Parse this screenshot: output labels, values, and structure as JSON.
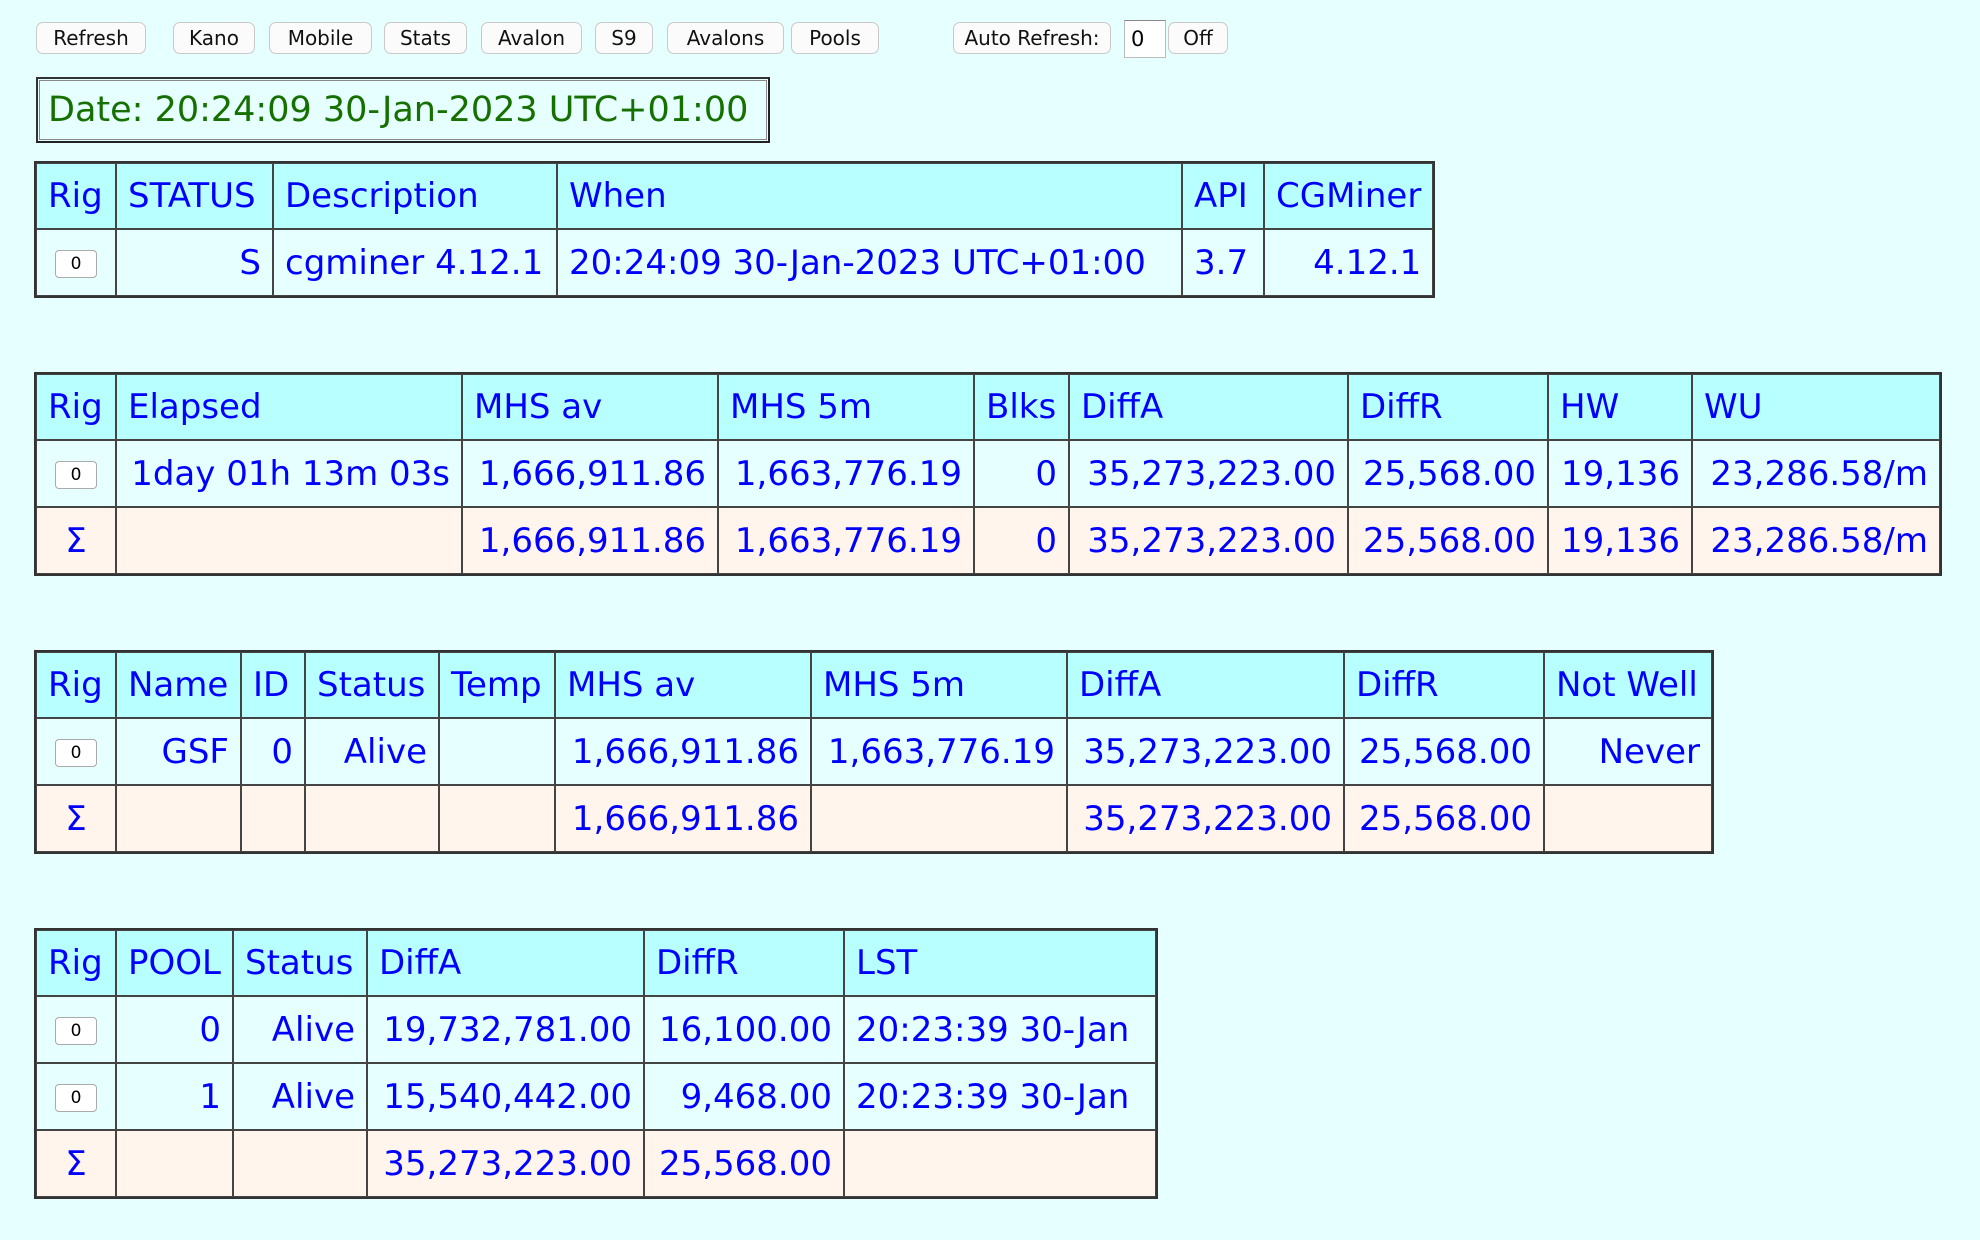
{
  "toolbar": {
    "buttons": [
      "Refresh",
      "Kano",
      "Mobile",
      "Stats",
      "Avalon",
      "S9",
      "Avalons",
      "Pools"
    ],
    "auto_refresh_label": "Auto Refresh:",
    "auto_refresh_value": "0",
    "off_label": "Off"
  },
  "date": "Date: 20:24:09 30-Jan-2023 UTC+01:00",
  "summary": {
    "headers": [
      "Rig",
      "STATUS",
      "Description",
      "When",
      "API",
      "CGMiner"
    ],
    "row": {
      "rig": "0",
      "status": "S",
      "description": "cgminer 4.12.1",
      "when": "20:24:09 30-Jan-2023 UTC+01:00",
      "api": "3.7",
      "cgminer": "4.12.1"
    }
  },
  "devs": {
    "headers": [
      "Rig",
      "Elapsed",
      "MHS av",
      "MHS 5m",
      "Blks",
      "DiffA",
      "DiffR",
      "HW",
      "WU"
    ],
    "row": {
      "rig": "0",
      "elapsed": "1day 01h 13m 03s",
      "mhs_av": "1,666,911.86",
      "mhs_5m": "1,663,776.19",
      "blks": "0",
      "diffa": "35,273,223.00",
      "diffr": "25,568.00",
      "hw": "19,136",
      "wu": "23,286.58/m"
    },
    "total": {
      "rig": "Σ",
      "elapsed": "",
      "mhs_av": "1,666,911.86",
      "mhs_5m": "1,663,776.19",
      "blks": "0",
      "diffa": "35,273,223.00",
      "diffr": "25,568.00",
      "hw": "19,136",
      "wu": "23,286.58/m"
    }
  },
  "gpus": {
    "headers": [
      "Rig",
      "Name",
      "ID",
      "Status",
      "Temp",
      "MHS av",
      "MHS 5m",
      "DiffA",
      "DiffR",
      "Not Well"
    ],
    "row": {
      "rig": "0",
      "name": "GSF",
      "id": "0",
      "status": "Alive",
      "temp": "",
      "mhs_av": "1,666,911.86",
      "mhs_5m": "1,663,776.19",
      "diffa": "35,273,223.00",
      "diffr": "25,568.00",
      "not_well": "Never"
    },
    "total": {
      "rig": "Σ",
      "mhs_av": "1,666,911.86",
      "diffa": "35,273,223.00",
      "diffr": "25,568.00"
    }
  },
  "pools": {
    "headers": [
      "Rig",
      "POOL",
      "Status",
      "DiffA",
      "DiffR",
      "LST"
    ],
    "rows": [
      {
        "rig": "0",
        "pool": "0",
        "status": "Alive",
        "diffa": "19,732,781.00",
        "diffr": "16,100.00",
        "lst": "20:23:39 30-Jan"
      },
      {
        "rig": "0",
        "pool": "1",
        "status": "Alive",
        "diffa": "15,540,442.00",
        "diffr": "9,468.00",
        "lst": "20:23:39 30-Jan"
      }
    ],
    "total": {
      "rig": "Σ",
      "diffa": "35,273,223.00",
      "diffr": "25,568.00"
    }
  }
}
